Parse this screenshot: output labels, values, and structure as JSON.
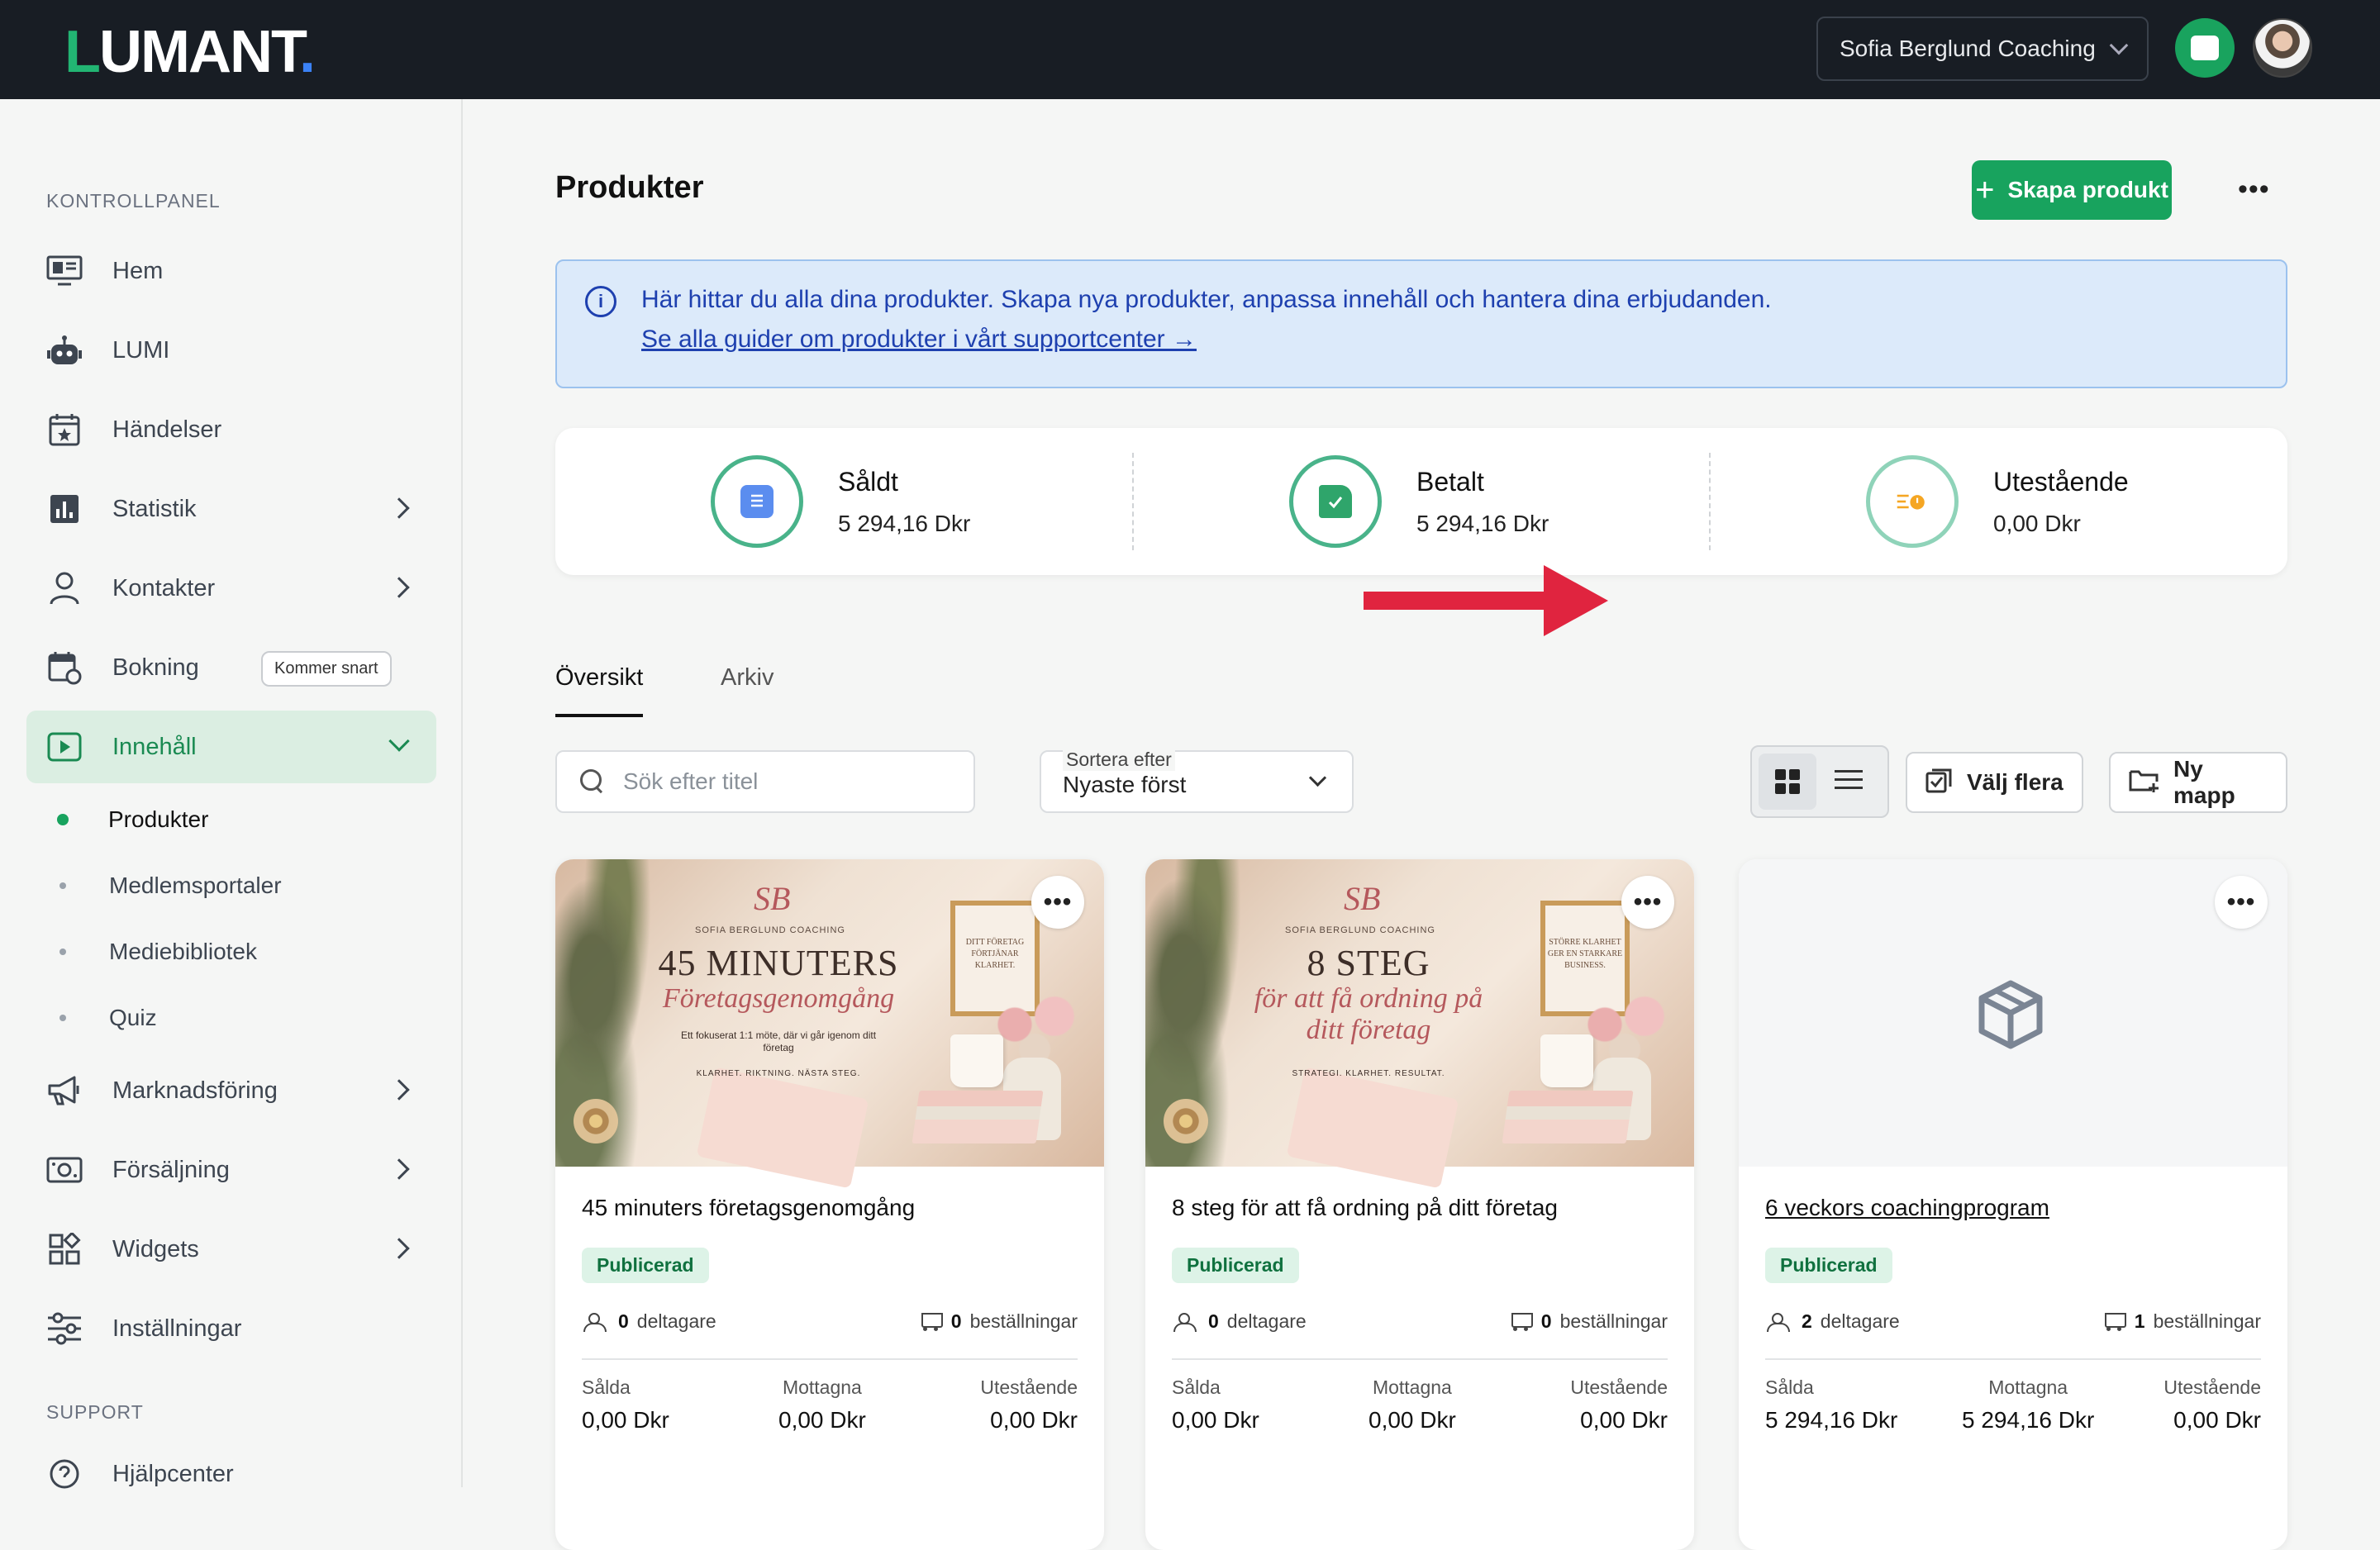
{
  "topbar": {
    "logo_main": "L",
    "logo_rest": "UMANT",
    "logo_dot": ".",
    "org_name": "Sofia Berglund Coaching",
    "chat_icon": "chat-bubble-icon",
    "avatar_icon": "user-avatar"
  },
  "sidebar": {
    "section_main": "KONTROLLPANEL",
    "section_support": "SUPPORT",
    "items": [
      {
        "label": "Hem",
        "icon": "monitor-icon"
      },
      {
        "label": "LUMI",
        "icon": "robot-icon"
      },
      {
        "label": "Händelser",
        "icon": "calendar-star-icon"
      },
      {
        "label": "Statistik",
        "icon": "bar-chart-icon"
      },
      {
        "label": "Kontakter",
        "icon": "person-icon"
      },
      {
        "label": "Bokning",
        "icon": "calendar-sync-icon",
        "badge": "Kommer snart"
      },
      {
        "label": "Innehåll",
        "icon": "play-icon"
      },
      {
        "label": "Marknadsföring",
        "icon": "megaphone-icon"
      },
      {
        "label": "Försäljning",
        "icon": "cash-icon"
      },
      {
        "label": "Widgets",
        "icon": "widgets-icon"
      },
      {
        "label": "Inställningar",
        "icon": "sliders-icon"
      },
      {
        "label": "Hjälpcenter",
        "icon": "help-icon"
      }
    ],
    "sub_items": [
      {
        "label": "Produkter"
      },
      {
        "label": "Medlemsportaler"
      },
      {
        "label": "Mediebibliotek"
      },
      {
        "label": "Quiz"
      }
    ]
  },
  "main": {
    "title": "Produkter",
    "create_label": "Skapa produkt",
    "more_label": "•••",
    "info": {
      "text": "Här hittar du alla dina produkter. Skapa nya produkter, anpassa innehåll och hantera dina erbjudanden.",
      "link": "Se alla guider om produkter i vårt supportcenter →"
    },
    "stats": [
      {
        "label": "Såldt",
        "value": "5 294,16 Dkr",
        "color": "#4a78e0"
      },
      {
        "label": "Betalt",
        "value": "5 294,16 Dkr",
        "color": "#2fa56b"
      },
      {
        "label": "Utestående",
        "value": "0,00 Dkr",
        "color": "#f5a623"
      }
    ],
    "tabs": [
      {
        "label": "Översikt"
      },
      {
        "label": "Arkiv"
      }
    ],
    "search_placeholder": "Sök efter titel",
    "sort": {
      "label": "Sortera efter",
      "value": "Nyaste först"
    },
    "toolbar": {
      "select_multiple": "Välj flera",
      "new_folder": "Ny mapp"
    },
    "cards": [
      {
        "title": "45 minuters företagsgenomgång",
        "status": "Publicerad",
        "participants_num": "0",
        "participants_label": "deltagare",
        "orders_num": "0",
        "orders_label": "beställningar",
        "sold_label": "Sålda",
        "sold": "0,00 Dkr",
        "received_label": "Mottagna",
        "received": "0,00 Dkr",
        "outstanding_label": "Utestående",
        "outstanding": "0,00 Dkr",
        "thumb": {
          "logo": "SB",
          "brand": "SOFIA BERGLUND COACHING",
          "main": "45 MINUTERS",
          "script": "Företagsgenomgång",
          "small": "Ett fokuserat 1:1 möte, där vi går igenom ditt företag",
          "tag": "KLARHET. RIKTNING. NÄSTA STEG.",
          "frame": "DITT FÖRETAG FÖRTJÄNAR KLARHET."
        }
      },
      {
        "title": "8 steg för att få ordning på ditt företag",
        "status": "Publicerad",
        "participants_num": "0",
        "participants_label": "deltagare",
        "orders_num": "0",
        "orders_label": "beställningar",
        "sold_label": "Sålda",
        "sold": "0,00 Dkr",
        "received_label": "Mottagna",
        "received": "0,00 Dkr",
        "outstanding_label": "Utestående",
        "outstanding": "0,00 Dkr",
        "thumb": {
          "logo": "SB",
          "brand": "SOFIA BERGLUND COACHING",
          "main": "8 STEG",
          "script": "för att få ordning på ditt företag",
          "small": "",
          "tag": "STRATEGI. KLARHET. RESULTAT.",
          "frame": "STÖRRE KLARHET GER EN STARKARE BUSINESS."
        }
      },
      {
        "title": "6 veckors coachingprogram",
        "status": "Publicerad",
        "participants_num": "2",
        "participants_label": "deltagare",
        "orders_num": "1",
        "orders_label": "beställningar",
        "sold_label": "Sålda",
        "sold": "5 294,16 Dkr",
        "received_label": "Mottagna",
        "received": "5 294,16 Dkr",
        "outstanding_label": "Utestående",
        "outstanding": "0,00 Dkr"
      }
    ]
  }
}
